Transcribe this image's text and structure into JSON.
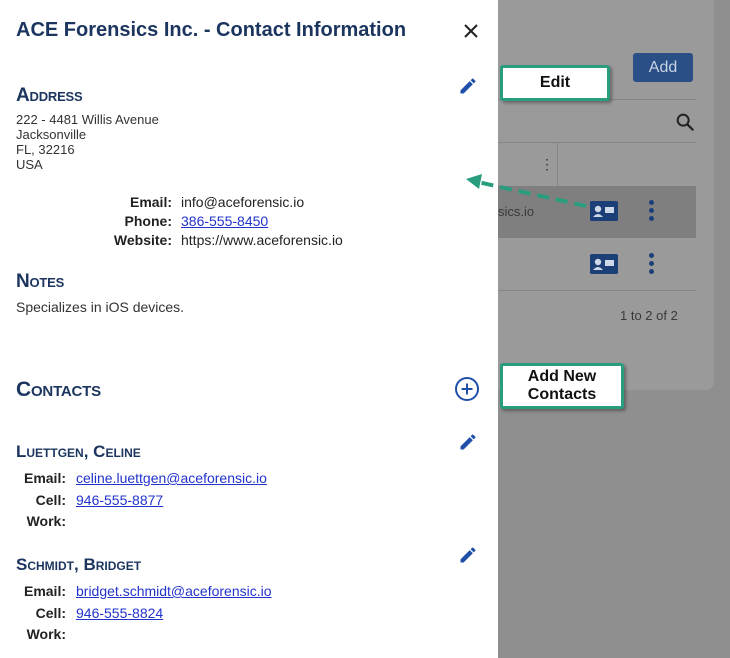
{
  "background": {
    "add_label": "Add",
    "row1_text": "sics.io",
    "pagination": "1 to 2 of 2"
  },
  "drawer": {
    "title": "ACE Forensics Inc. - Contact Information",
    "address": {
      "heading": "Address",
      "line1": "222 - 4481 Willis Avenue",
      "line2": "Jacksonville",
      "line3": "FL, 32216",
      "line4": "USA"
    },
    "info": {
      "email_label": "Email:",
      "email": "info@aceforensic.io",
      "phone_label": "Phone:",
      "phone": "386-555-8450",
      "website_label": "Website:",
      "website": "https://www.aceforensic.io"
    },
    "notes": {
      "heading": "Notes",
      "text": "Specializes in iOS devices."
    },
    "contacts": {
      "heading": "Contacts",
      "items": [
        {
          "name": "Luettgen, Celine",
          "email_label": "Email:",
          "email": "celine.luettgen@aceforensic.io",
          "cell_label": "Cell:",
          "cell": "946-555-8877",
          "work_label": "Work:",
          "work": ""
        },
        {
          "name": "Schmidt, Bridget",
          "email_label": "Email:",
          "email": "bridget.schmidt@aceforensic.io",
          "cell_label": "Cell:",
          "cell": "946-555-8824",
          "work_label": "Work:",
          "work": ""
        }
      ]
    }
  },
  "callouts": {
    "edit": "Edit",
    "add_new_line1": "Add New",
    "add_new_line2": "Contacts"
  },
  "colors": {
    "brand_navy": "#1b355e",
    "icon_blue": "#1f4fa8",
    "callout_border": "#2a9d7f",
    "link": "#2233cc"
  },
  "icons": [
    "close-icon",
    "edit-icon",
    "add-circle-icon",
    "search-icon",
    "contact-card-icon",
    "kebab-icon"
  ]
}
